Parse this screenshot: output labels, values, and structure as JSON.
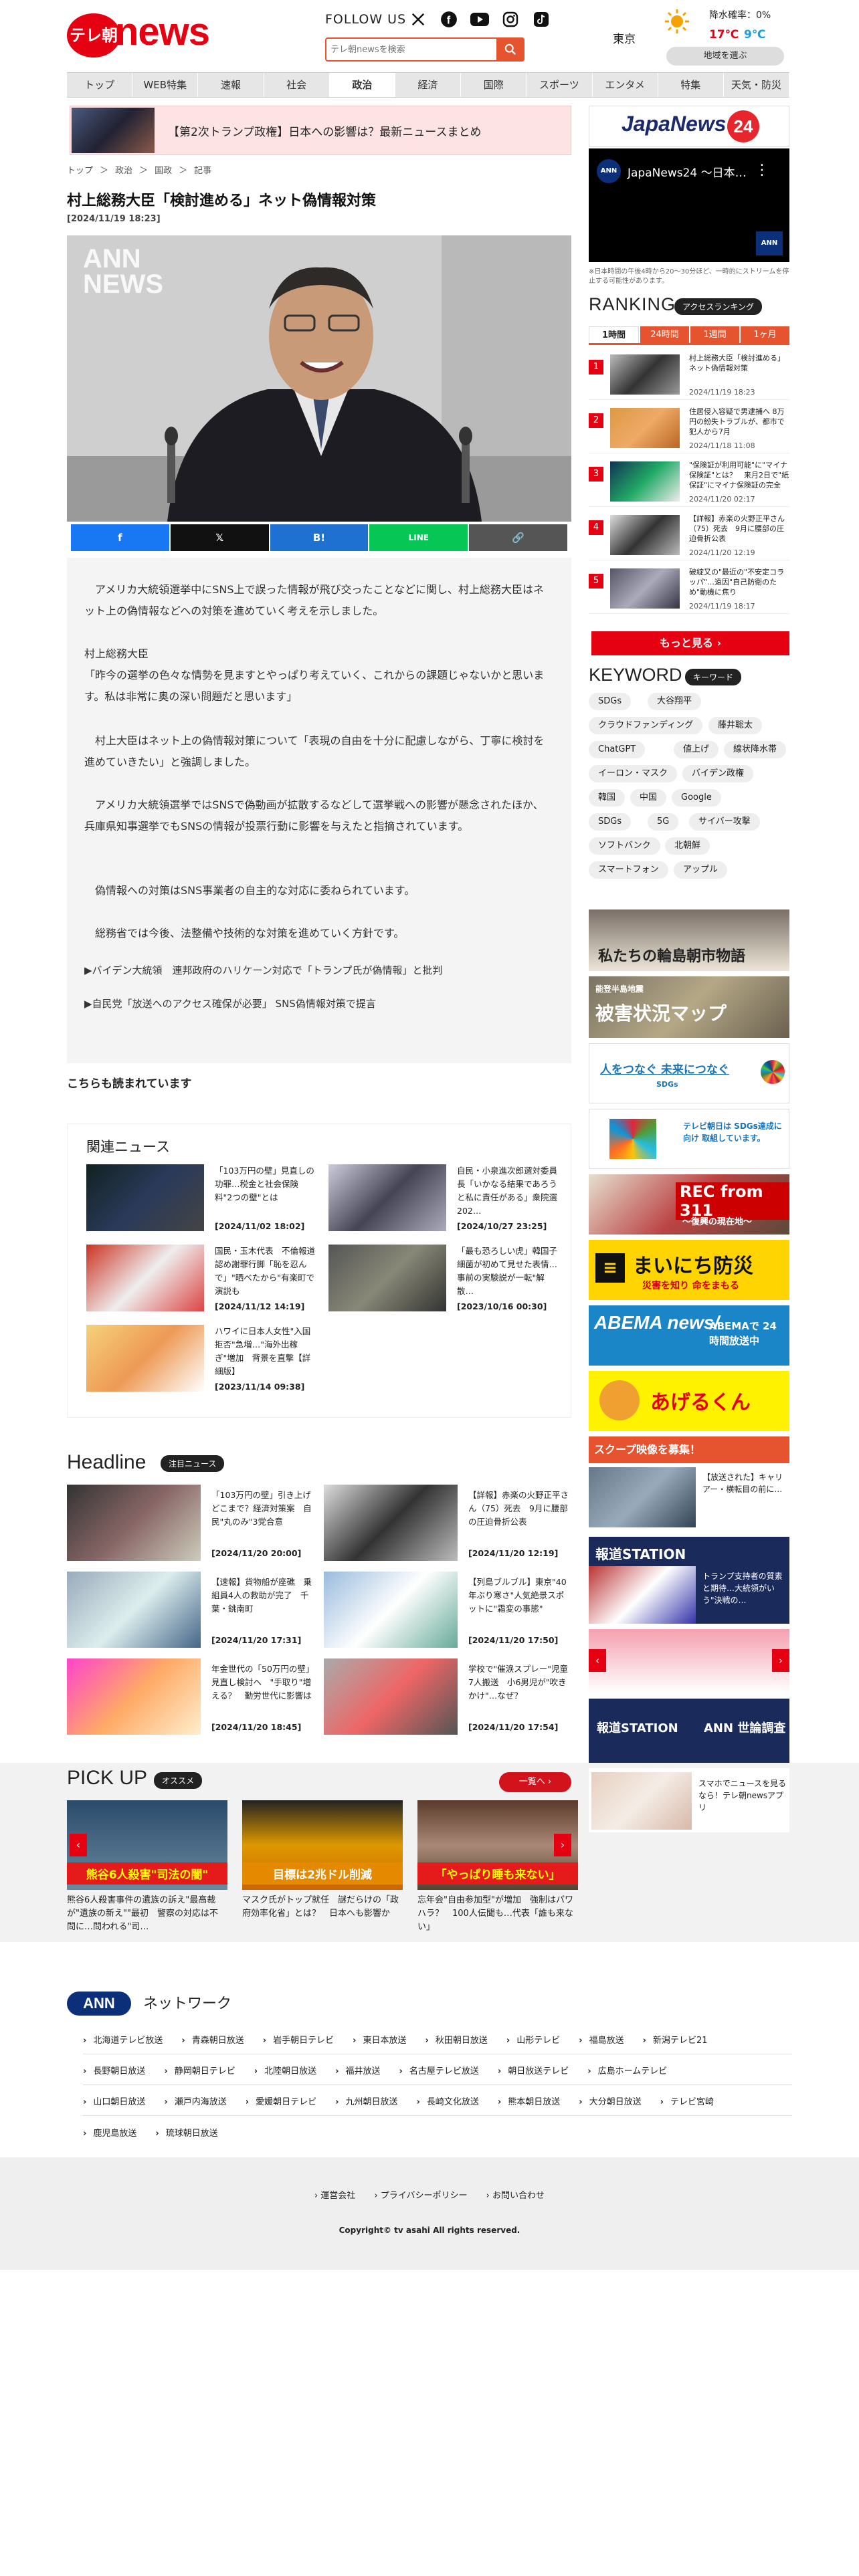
{
  "header": {
    "logo_circle": "テレ朝",
    "logo_word": "news",
    "follow_label": "FOLLOW US",
    "search_placeholder": "テレ朝newsを検索",
    "weather": {
      "city": "東京",
      "rain": "降水確率：0%",
      "high": "17℃",
      "low": "9℃",
      "region_button": "地域を選ぶ"
    }
  },
  "nav": [
    "トップ",
    "WEB特集",
    "速報",
    "社会",
    "政治",
    "経済",
    "国際",
    "スポーツ",
    "エンタメ",
    "特集",
    "天気・防災"
  ],
  "nav_active": 4,
  "banner": {
    "text": "【第2次トランプ政権】日本への影響は？最新ニュースまとめ"
  },
  "breadcrumb": [
    "トップ",
    "＞",
    "政治",
    "＞",
    "国政",
    "＞",
    "記事"
  ],
  "article": {
    "title": "村上総務大臣「検討進める」ネット偽情報対策",
    "date": "[2024/11/19 18:23]",
    "watermark_1": "ANN",
    "watermark_2": "NEWS",
    "paragraphs": [
      "アメリカ大統領選挙中にSNS上で誤った情報が飛び交ったことなどに関し、村上総務大臣はネット上の偽情報などへの対策を進めていく考えを示しました。",
      "村上総務大臣\n「昨今の選挙の色々な情勢を見ますとやっぱり考えていく、これからの課題じゃないかと思います。私は非常に奥の深い問題だと思います」",
      "村上大臣はネット上の偽情報対策について「表現の自由を十分に配慮しながら、丁寧に検討を進めていきたい」と強調しました。",
      "アメリカ大統領選挙ではSNSで偽動画が拡散するなどして選挙戦への影響が懸念されたほか、兵庫県知事選挙でもSNSの情報が投票行動に影響を与えたと指摘されています。",
      "偽情報への対策はSNS事業者の自主的な対応に委ねられています。",
      "総務省では今後、法整備や技術的な対策を進めていく方針です。"
    ],
    "related_links": [
      "▶バイデン大統領　連邦政府のハリケーン対応で「トランプ氏が偽情報」と批判",
      "▶自民党「放送へのアクセス確保が必要」 SNS偽情報対策で提言"
    ]
  },
  "share_bar": [
    "f",
    "𝕏",
    "B!",
    "LINE",
    "🔗"
  ],
  "also_read": "こちらも読まれています",
  "related_news": {
    "title": "関連ニュース",
    "items": [
      {
        "text": "「103万円の壁」見直しの功罪…税金と社会保険料\"2つの壁\"とは",
        "date": "[2024/11/02 18:02]"
      },
      {
        "text": "自民・小泉進次郎選対委員長「いかなる結果であろうと私に責任がある」衆院選202…",
        "date": "[2024/10/27 23:25]"
      },
      {
        "text": "国民・玉木代表　不倫報道認め謝罪行脚「恥を忍んで」\"晒べたから\"有楽町で演説も",
        "date": "[2024/11/12 14:19]"
      },
      {
        "text": "「最も恐ろしい虎」韓国子細菌が初めて見せた表情…事前の実験説が一転\"解散…",
        "date": "[2023/10/16 00:30]"
      },
      {
        "text": "ハワイに日本人女性\"入国拒否\"急増…\"海外出稼ぎ\"増加　背景を直撃【詳細版】",
        "date": "[2023/11/14 09:38]"
      }
    ]
  },
  "headline": {
    "title": "Headline",
    "badge": "注目ニュース",
    "items": [
      {
        "text": "「103万円の壁」引き上げどこまで？経済対策案　自民\"丸のみ\"3党合意",
        "date": "[2024/11/20 20:00]"
      },
      {
        "text": "【詳報】赤楽の火野正平さん（75）死去　9月に腰部の圧迫骨折公表",
        "date": "[2024/11/20 12:19]"
      },
      {
        "text": "【速報】貨物船が座礁　乗組員4人の救助が完了　千葉・銚南町",
        "date": "[2024/11/20 17:31]"
      },
      {
        "text": "【列島ブルブル】東京\"40年ぶり寒さ\"人気絶景スポットに\"霜変の事態\"",
        "date": "[2024/11/20 17:50]"
      },
      {
        "text": "年金世代の「50万円の壁」見直し検討へ　\"手取り\"増える？　勤労世代に影響は",
        "date": "[2024/11/20 18:45]"
      },
      {
        "text": "学校で\"催涙スプレー\"児童7人搬送　小6男児が\"吹きかけ\"…なぜ？",
        "date": "[2024/11/20 17:54]"
      }
    ]
  },
  "pickup": {
    "title": "PICK UP",
    "badge": "オススメ",
    "more": "一覧へ ›",
    "items": [
      {
        "caption": "熊谷6人殺害\"司法の闇\"",
        "text": "熊谷6人殺害事件の遺族の訴え\"最高裁が\"遺族の新え\"\"最初　警察の対応は不問に…問われる\"司…"
      },
      {
        "caption": "目標は2兆ドル削減",
        "text": "マスク氏がトップ就任　謎だらけの「政府効率化省」とは？　日本へも影響か"
      },
      {
        "caption": "「やっぱり睡も来ない」",
        "text": "忘年会\"自由参加型\"が増加　強制はパワハラ？　100人伝聞も…代表「誰も来ない」"
      }
    ]
  },
  "network": {
    "title": "ネットワーク",
    "logo": "ANN",
    "rows": [
      [
        "北海道テレビ放送",
        "青森朝日放送",
        "岩手朝日テレビ",
        "東日本放送",
        "秋田朝日放送",
        "山形テレビ",
        "福島放送",
        "新潟テレビ21"
      ],
      [
        "長野朝日放送",
        "静岡朝日テレビ",
        "北陸朝日放送",
        "福井放送",
        "名古屋テレビ放送",
        "朝日放送テレビ",
        "広島ホームテレビ"
      ],
      [
        "山口朝日放送",
        "瀬戸内海放送",
        "愛媛朝日テレビ",
        "九州朝日放送",
        "長崎文化放送",
        "熊本朝日放送",
        "大分朝日放送",
        "テレビ宮崎"
      ],
      [
        "鹿児島放送",
        "琉球朝日放送"
      ]
    ]
  },
  "footer": {
    "links": [
      "› 運営会社",
      "› プライバシーポリシー",
      "› お問い合わせ"
    ],
    "copyright": "Copyright© tv asahi All rights reserved."
  },
  "sidebar": {
    "jn24_title": "JapaNews",
    "jn24_num": "24",
    "video_title": "JapaNews24 ～日本…",
    "live_note": "※日本時間の午後4時から20～30分ほど、一時的にストリームを停止する可能性があります。",
    "ranking": {
      "title": "RANKING",
      "badge": "アクセスランキング",
      "tabs": [
        "1時間",
        "24時間",
        "1週間",
        "1ヶ月"
      ],
      "items": [
        {
          "num": "1",
          "text": "村上総務大臣「検討進める」ネット偽情報対策",
          "date": "2024/11/19 18:23"
        },
        {
          "num": "2",
          "text": "住居侵入容疑で男逮捕へ 8万円の紛失トラブルが、都市で犯人から7月",
          "date": "2024/11/18 11:08"
        },
        {
          "num": "3",
          "text": "\"保険証が利用可能\"に\"マイナ保険証\"とは？　来月2日で\"紙保証\"にマイナ保険証の完全",
          "date": "2024/11/20 02:17"
        },
        {
          "num": "4",
          "text": "【詳報】赤楽の火野正平さん（75）死去　9月に腰部の圧迫骨折公表",
          "date": "2024/11/20 12:19"
        },
        {
          "num": "5",
          "text": "破綻又の\"最近の\"不安定コラッパ\"…遠因\"自己防衛のため\"動機に焦り",
          "date": "2024/11/19 18:17"
        }
      ],
      "more": "もっと見る ›"
    },
    "keyword": {
      "title": "KEYWORD",
      "badge": "キーワード",
      "rows": [
        [
          "SDGs",
          "大谷翔平"
        ],
        [
          "クラウドファンディング",
          "藤井聡太"
        ],
        [
          "ChatGPT",
          "値上げ",
          "線状降水帯"
        ],
        [
          "イーロン・マスク",
          "バイデン政権"
        ],
        [
          "韓国",
          "中国",
          "Google"
        ],
        [
          "SDGs",
          "5G",
          "サイバー攻撃"
        ],
        [
          "ソフトバンク",
          "北朝鮮"
        ],
        [
          "スマートフォン",
          "アップル"
        ]
      ]
    },
    "ads": {
      "noto": "私たちの輪島朝市物語",
      "map_small": "能登半島地震",
      "map": "被害状況マップ",
      "sdgs": "人をつなぐ 未来につなぐ",
      "sdgs_sub": "SDGs",
      "sdgs2": "テレビ朝日は SDGs達成に向け 取組しています。",
      "rec": "REC from 311",
      "rec_sub": "～復興の現在地～",
      "mainichi": "まいにち防災",
      "mainichi_sub": "災害を知り 命をまもる",
      "abema": "ABEMA news/",
      "abema_sub": "ABEMAで 24時間放送中",
      "agerun": "あげるくん",
      "scoop": "スクープ映像を募集！",
      "scoop_text": "【放送された】キャリアー・横転目の前に…",
      "houdou": "報道STATION",
      "houdou_text": "トランプ支持者の質素と期待…大統領がいう\"決戦の…",
      "houdou2": "報道STATION",
      "houdou2_sub": "ANN 世論調査",
      "news_app": "スマホでニュースを見るなら！テレ朝newsアプリ"
    }
  }
}
